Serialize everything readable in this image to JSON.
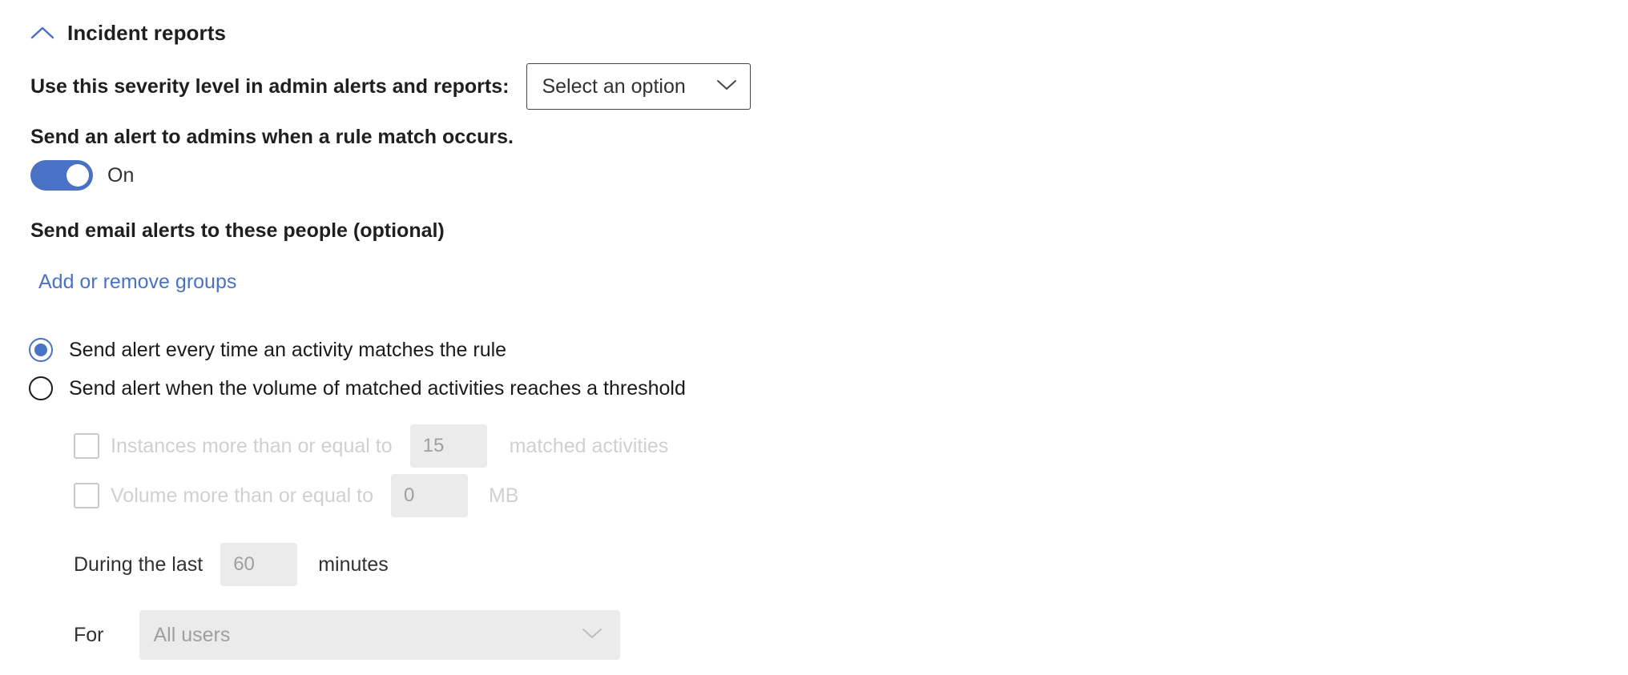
{
  "section": {
    "title": "Incident reports",
    "collapse_icon": "chevron-up-icon",
    "expanded": true
  },
  "severity": {
    "label": "Use this severity level in admin alerts and reports:",
    "dropdown_value": "Select an option",
    "dropdown_icon": "chevron-down-icon"
  },
  "admin_alert": {
    "label": "Send an alert to admins when a rule match occurs.",
    "toggle_state": "On",
    "toggle_on": true,
    "toggle_color": "#4a72c4"
  },
  "email_alerts": {
    "label": "Send email alerts to these people (optional)",
    "link_label": "Add or remove groups",
    "link_color": "#4a72c4"
  },
  "alert_mode": {
    "options": [
      {
        "label": "Send alert every time an activity matches the rule",
        "selected": true
      },
      {
        "label": "Send alert when the volume of matched activities reaches a threshold",
        "selected": false
      }
    ]
  },
  "threshold": {
    "instances": {
      "checkbox_checked": false,
      "label": "Instances more than or equal to",
      "value": "15",
      "unit": "matched activities",
      "disabled": true
    },
    "volume": {
      "checkbox_checked": false,
      "label": "Volume more than or equal to",
      "value": "0",
      "unit": "MB",
      "disabled": true
    },
    "duration": {
      "prefix_label": "During the last",
      "value": "60",
      "unit": "minutes",
      "disabled": true
    },
    "scope": {
      "prefix_label": "For",
      "value": "All users",
      "dropdown_icon": "chevron-down-icon",
      "disabled": true
    }
  }
}
